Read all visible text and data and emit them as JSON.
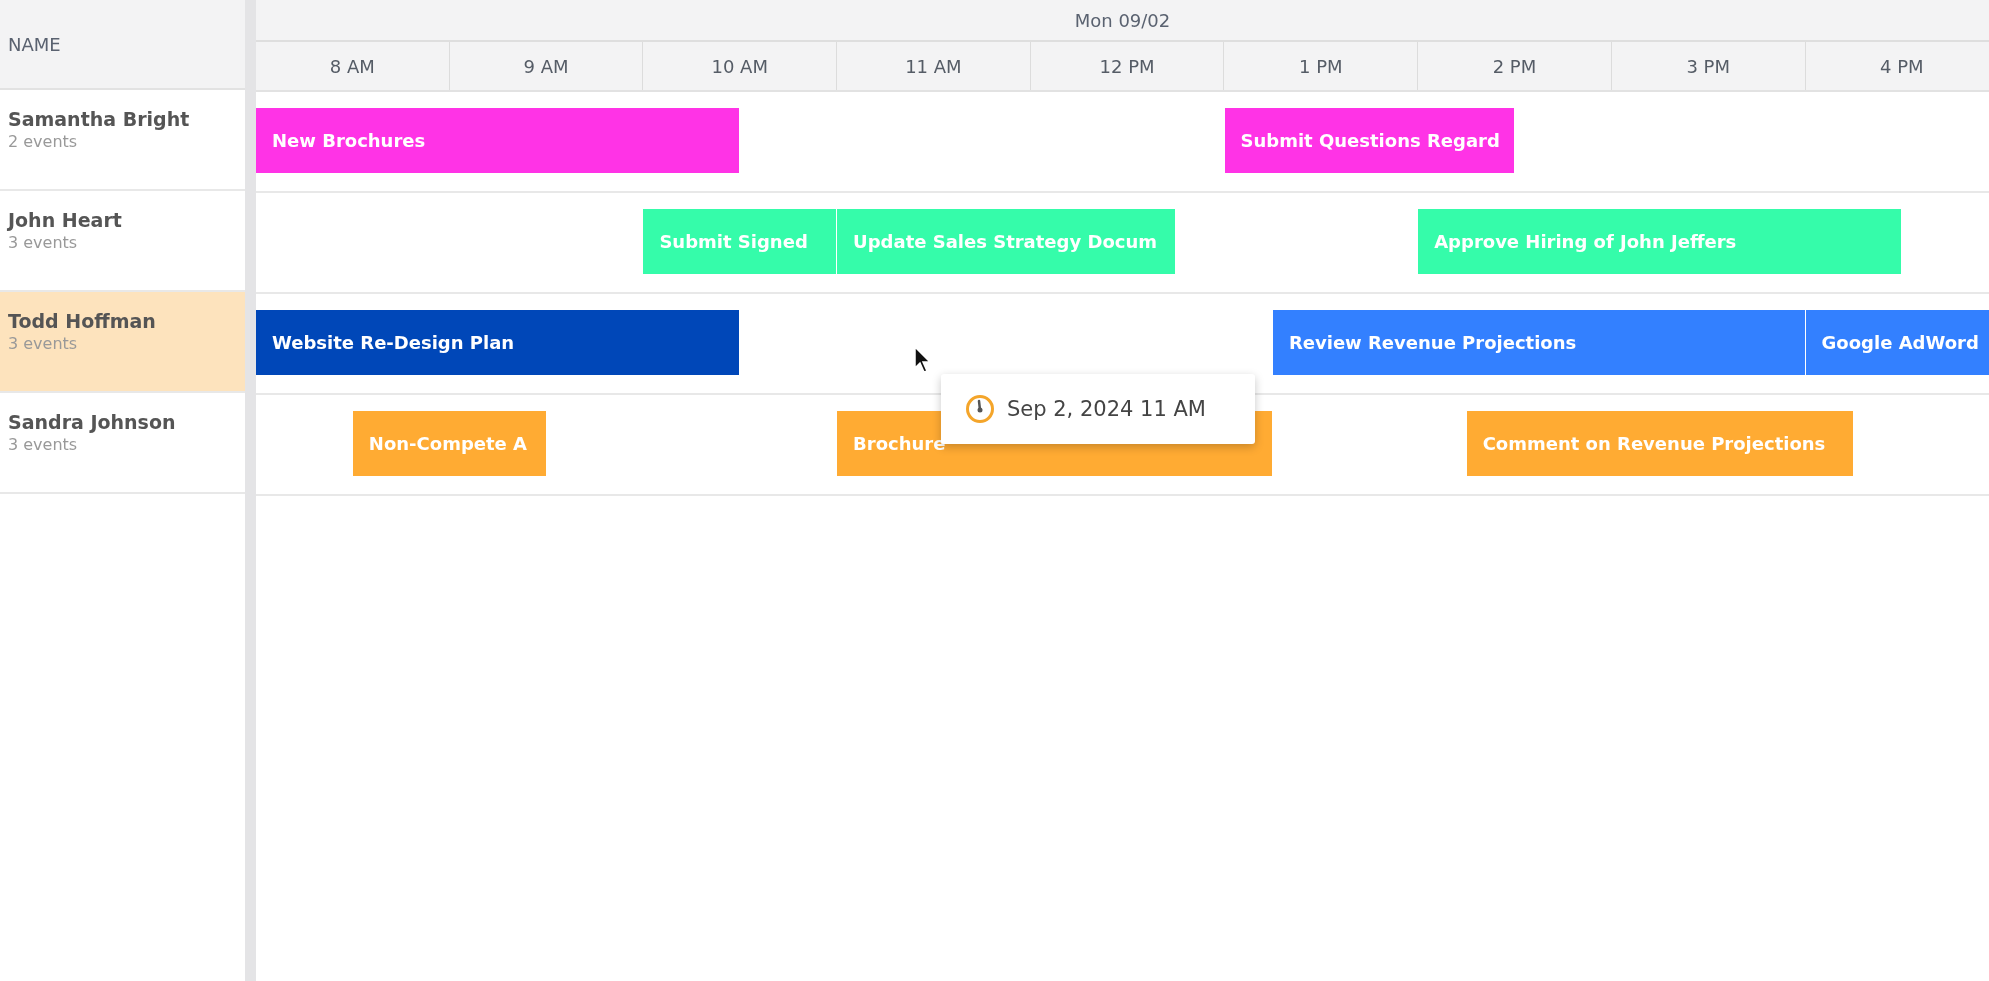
{
  "name_header": "NAME",
  "date_header": "Mon 09/02",
  "hours": [
    "8 AM",
    "9 AM",
    "10 AM",
    "11 AM",
    "12 PM",
    "1 PM",
    "2 PM",
    "3 PM",
    "4 PM"
  ],
  "resources": [
    {
      "name": "Samantha Bright",
      "count": "2 events",
      "selected": false,
      "events": [
        {
          "title": "New Brochures",
          "color": "#ff33e6"
        },
        {
          "title": "Submit Questions Regard",
          "color": "#ff33e6"
        }
      ]
    },
    {
      "name": "John Heart",
      "count": "3 events",
      "selected": false,
      "events": [
        {
          "title": "Submit Signed",
          "color": "#35fcaa"
        },
        {
          "title": "Update Sales Strategy Docum",
          "color": "#35fcaa"
        },
        {
          "title": "Approve Hiring of John Jeffers",
          "color": "#35fcaa"
        }
      ]
    },
    {
      "name": "Todd Hoffman",
      "count": "3 events",
      "selected": true,
      "events": [
        {
          "title": "Website Re-Design Plan",
          "color": "#0047b8"
        },
        {
          "title": "Review Revenue Projections",
          "color": "#3380ff"
        },
        {
          "title": "Google AdWord",
          "color": "#3380ff"
        }
      ]
    },
    {
      "name": "Sandra Johnson",
      "count": "3 events",
      "selected": false,
      "events": [
        {
          "title": "Non-Compete A",
          "color": "#ffab33"
        },
        {
          "title": "Brochure",
          "color": "#ffab33"
        },
        {
          "title": "Comment on Revenue Projections",
          "color": "#ffab33"
        }
      ]
    }
  ],
  "tooltip": {
    "text": "Sep 2, 2024 11 AM"
  }
}
